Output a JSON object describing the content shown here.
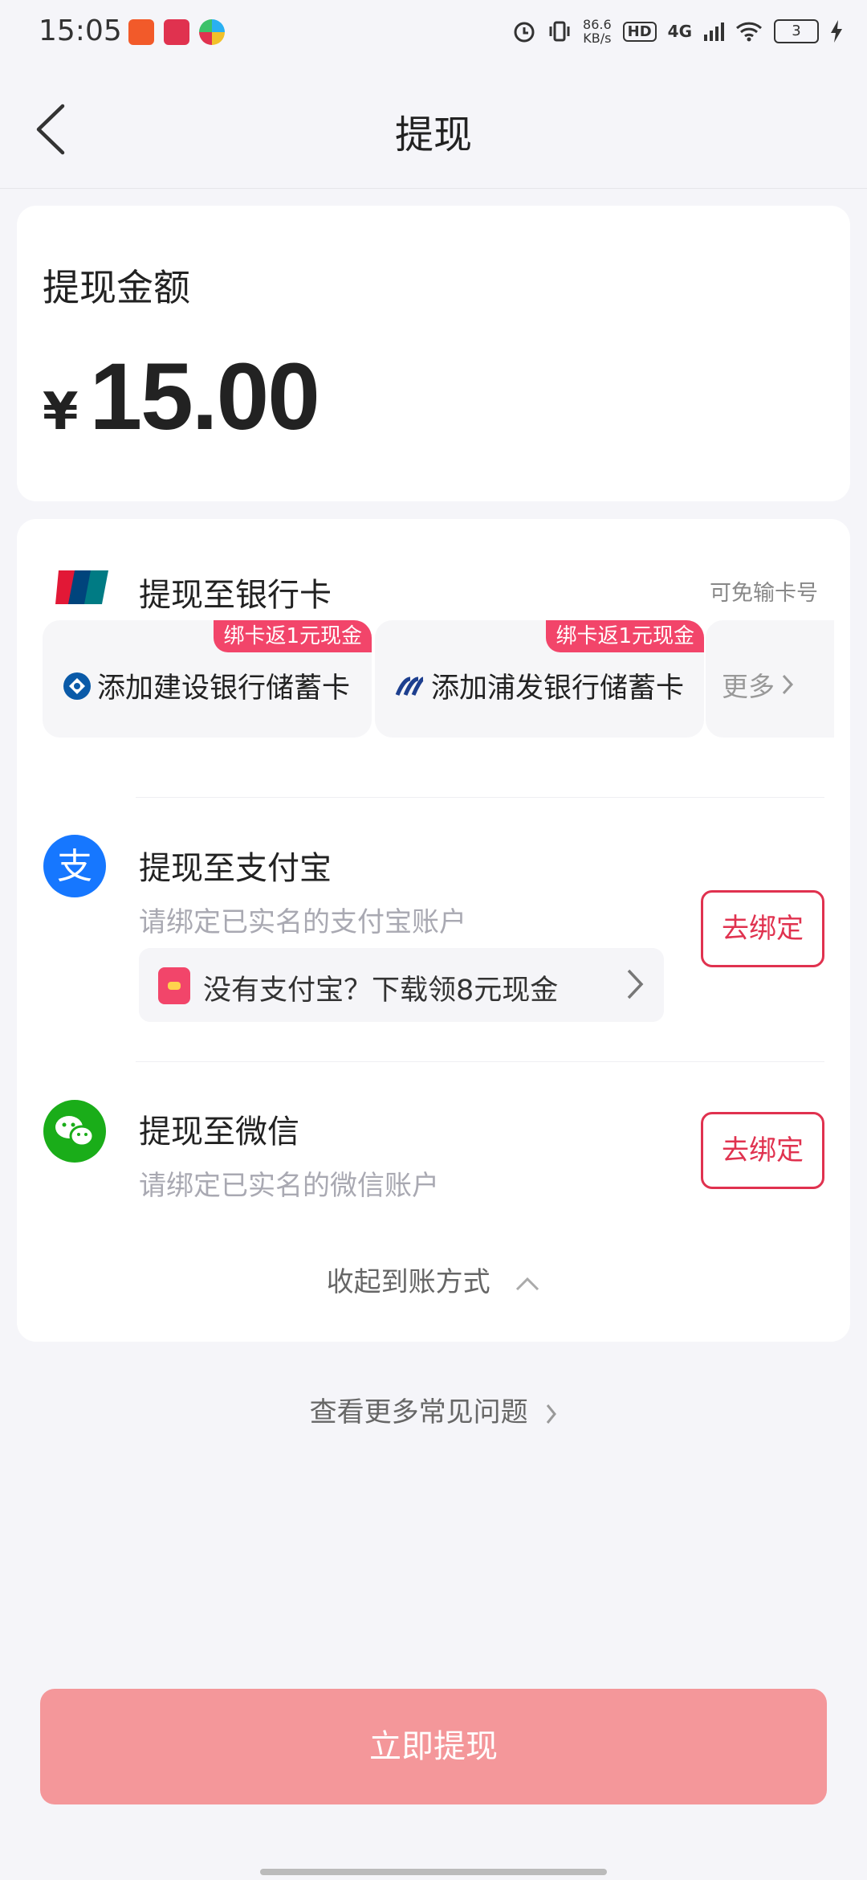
{
  "status_bar": {
    "time": "15:05",
    "net_speed_value": "86.6",
    "net_speed_unit": "KB/s",
    "hd_label": "HD",
    "network": "4G",
    "battery": "3"
  },
  "header": {
    "title": "提现"
  },
  "amount_section": {
    "label": "提现金额",
    "currency": "¥",
    "value": "15.00"
  },
  "bank_section": {
    "title": "提现至银行卡",
    "note": "可免输卡号",
    "options": [
      {
        "badge": "绑卡返1元现金",
        "label": "添加建设银行储蓄卡"
      },
      {
        "badge": "绑卡返1元现金",
        "label": "添加浦发银行储蓄卡"
      }
    ],
    "more_label": "更多"
  },
  "alipay_section": {
    "title": "提现至支付宝",
    "subtitle": "请绑定已实名的支付宝账户",
    "bind_label": "去绑定",
    "promo_text": "没有支付宝？下载领8元现金"
  },
  "wechat_section": {
    "title": "提现至微信",
    "subtitle": "请绑定已实名的微信账户",
    "bind_label": "去绑定"
  },
  "collapse_label": "收起到账方式",
  "faq_label": "查看更多常见问题",
  "submit_label": "立即提现",
  "colors": {
    "accent": "#e0324f",
    "badge": "#f2456a",
    "submit_bg": "#f4979a",
    "page_bg": "#f5f5f9"
  }
}
